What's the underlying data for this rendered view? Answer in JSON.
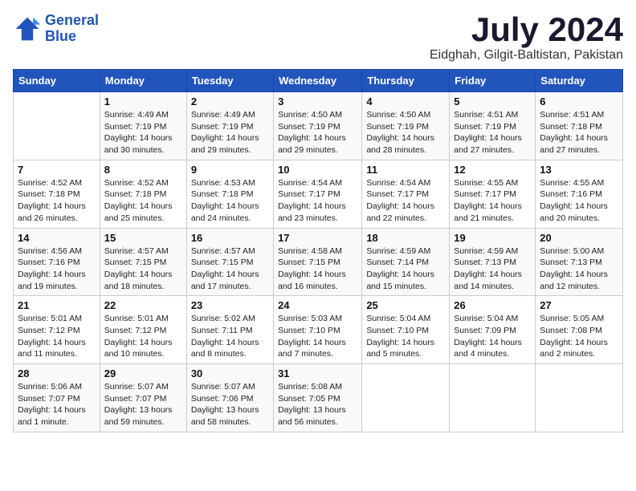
{
  "logo": {
    "line1": "General",
    "line2": "Blue"
  },
  "title": "July 2024",
  "subtitle": "Eidghah, Gilgit-Baltistan, Pakistan",
  "days_header": [
    "Sunday",
    "Monday",
    "Tuesday",
    "Wednesday",
    "Thursday",
    "Friday",
    "Saturday"
  ],
  "weeks": [
    [
      {
        "day": "",
        "info": ""
      },
      {
        "day": "1",
        "info": "Sunrise: 4:49 AM\nSunset: 7:19 PM\nDaylight: 14 hours\nand 30 minutes."
      },
      {
        "day": "2",
        "info": "Sunrise: 4:49 AM\nSunset: 7:19 PM\nDaylight: 14 hours\nand 29 minutes."
      },
      {
        "day": "3",
        "info": "Sunrise: 4:50 AM\nSunset: 7:19 PM\nDaylight: 14 hours\nand 29 minutes."
      },
      {
        "day": "4",
        "info": "Sunrise: 4:50 AM\nSunset: 7:19 PM\nDaylight: 14 hours\nand 28 minutes."
      },
      {
        "day": "5",
        "info": "Sunrise: 4:51 AM\nSunset: 7:19 PM\nDaylight: 14 hours\nand 27 minutes."
      },
      {
        "day": "6",
        "info": "Sunrise: 4:51 AM\nSunset: 7:18 PM\nDaylight: 14 hours\nand 27 minutes."
      }
    ],
    [
      {
        "day": "7",
        "info": "Sunrise: 4:52 AM\nSunset: 7:18 PM\nDaylight: 14 hours\nand 26 minutes."
      },
      {
        "day": "8",
        "info": "Sunrise: 4:52 AM\nSunset: 7:18 PM\nDaylight: 14 hours\nand 25 minutes."
      },
      {
        "day": "9",
        "info": "Sunrise: 4:53 AM\nSunset: 7:18 PM\nDaylight: 14 hours\nand 24 minutes."
      },
      {
        "day": "10",
        "info": "Sunrise: 4:54 AM\nSunset: 7:17 PM\nDaylight: 14 hours\nand 23 minutes."
      },
      {
        "day": "11",
        "info": "Sunrise: 4:54 AM\nSunset: 7:17 PM\nDaylight: 14 hours\nand 22 minutes."
      },
      {
        "day": "12",
        "info": "Sunrise: 4:55 AM\nSunset: 7:17 PM\nDaylight: 14 hours\nand 21 minutes."
      },
      {
        "day": "13",
        "info": "Sunrise: 4:55 AM\nSunset: 7:16 PM\nDaylight: 14 hours\nand 20 minutes."
      }
    ],
    [
      {
        "day": "14",
        "info": "Sunrise: 4:56 AM\nSunset: 7:16 PM\nDaylight: 14 hours\nand 19 minutes."
      },
      {
        "day": "15",
        "info": "Sunrise: 4:57 AM\nSunset: 7:15 PM\nDaylight: 14 hours\nand 18 minutes."
      },
      {
        "day": "16",
        "info": "Sunrise: 4:57 AM\nSunset: 7:15 PM\nDaylight: 14 hours\nand 17 minutes."
      },
      {
        "day": "17",
        "info": "Sunrise: 4:58 AM\nSunset: 7:15 PM\nDaylight: 14 hours\nand 16 minutes."
      },
      {
        "day": "18",
        "info": "Sunrise: 4:59 AM\nSunset: 7:14 PM\nDaylight: 14 hours\nand 15 minutes."
      },
      {
        "day": "19",
        "info": "Sunrise: 4:59 AM\nSunset: 7:13 PM\nDaylight: 14 hours\nand 14 minutes."
      },
      {
        "day": "20",
        "info": "Sunrise: 5:00 AM\nSunset: 7:13 PM\nDaylight: 14 hours\nand 12 minutes."
      }
    ],
    [
      {
        "day": "21",
        "info": "Sunrise: 5:01 AM\nSunset: 7:12 PM\nDaylight: 14 hours\nand 11 minutes."
      },
      {
        "day": "22",
        "info": "Sunrise: 5:01 AM\nSunset: 7:12 PM\nDaylight: 14 hours\nand 10 minutes."
      },
      {
        "day": "23",
        "info": "Sunrise: 5:02 AM\nSunset: 7:11 PM\nDaylight: 14 hours\nand 8 minutes."
      },
      {
        "day": "24",
        "info": "Sunrise: 5:03 AM\nSunset: 7:10 PM\nDaylight: 14 hours\nand 7 minutes."
      },
      {
        "day": "25",
        "info": "Sunrise: 5:04 AM\nSunset: 7:10 PM\nDaylight: 14 hours\nand 5 minutes."
      },
      {
        "day": "26",
        "info": "Sunrise: 5:04 AM\nSunset: 7:09 PM\nDaylight: 14 hours\nand 4 minutes."
      },
      {
        "day": "27",
        "info": "Sunrise: 5:05 AM\nSunset: 7:08 PM\nDaylight: 14 hours\nand 2 minutes."
      }
    ],
    [
      {
        "day": "28",
        "info": "Sunrise: 5:06 AM\nSunset: 7:07 PM\nDaylight: 14 hours\nand 1 minute."
      },
      {
        "day": "29",
        "info": "Sunrise: 5:07 AM\nSunset: 7:07 PM\nDaylight: 13 hours\nand 59 minutes."
      },
      {
        "day": "30",
        "info": "Sunrise: 5:07 AM\nSunset: 7:06 PM\nDaylight: 13 hours\nand 58 minutes."
      },
      {
        "day": "31",
        "info": "Sunrise: 5:08 AM\nSunset: 7:05 PM\nDaylight: 13 hours\nand 56 minutes."
      },
      {
        "day": "",
        "info": ""
      },
      {
        "day": "",
        "info": ""
      },
      {
        "day": "",
        "info": ""
      }
    ]
  ]
}
